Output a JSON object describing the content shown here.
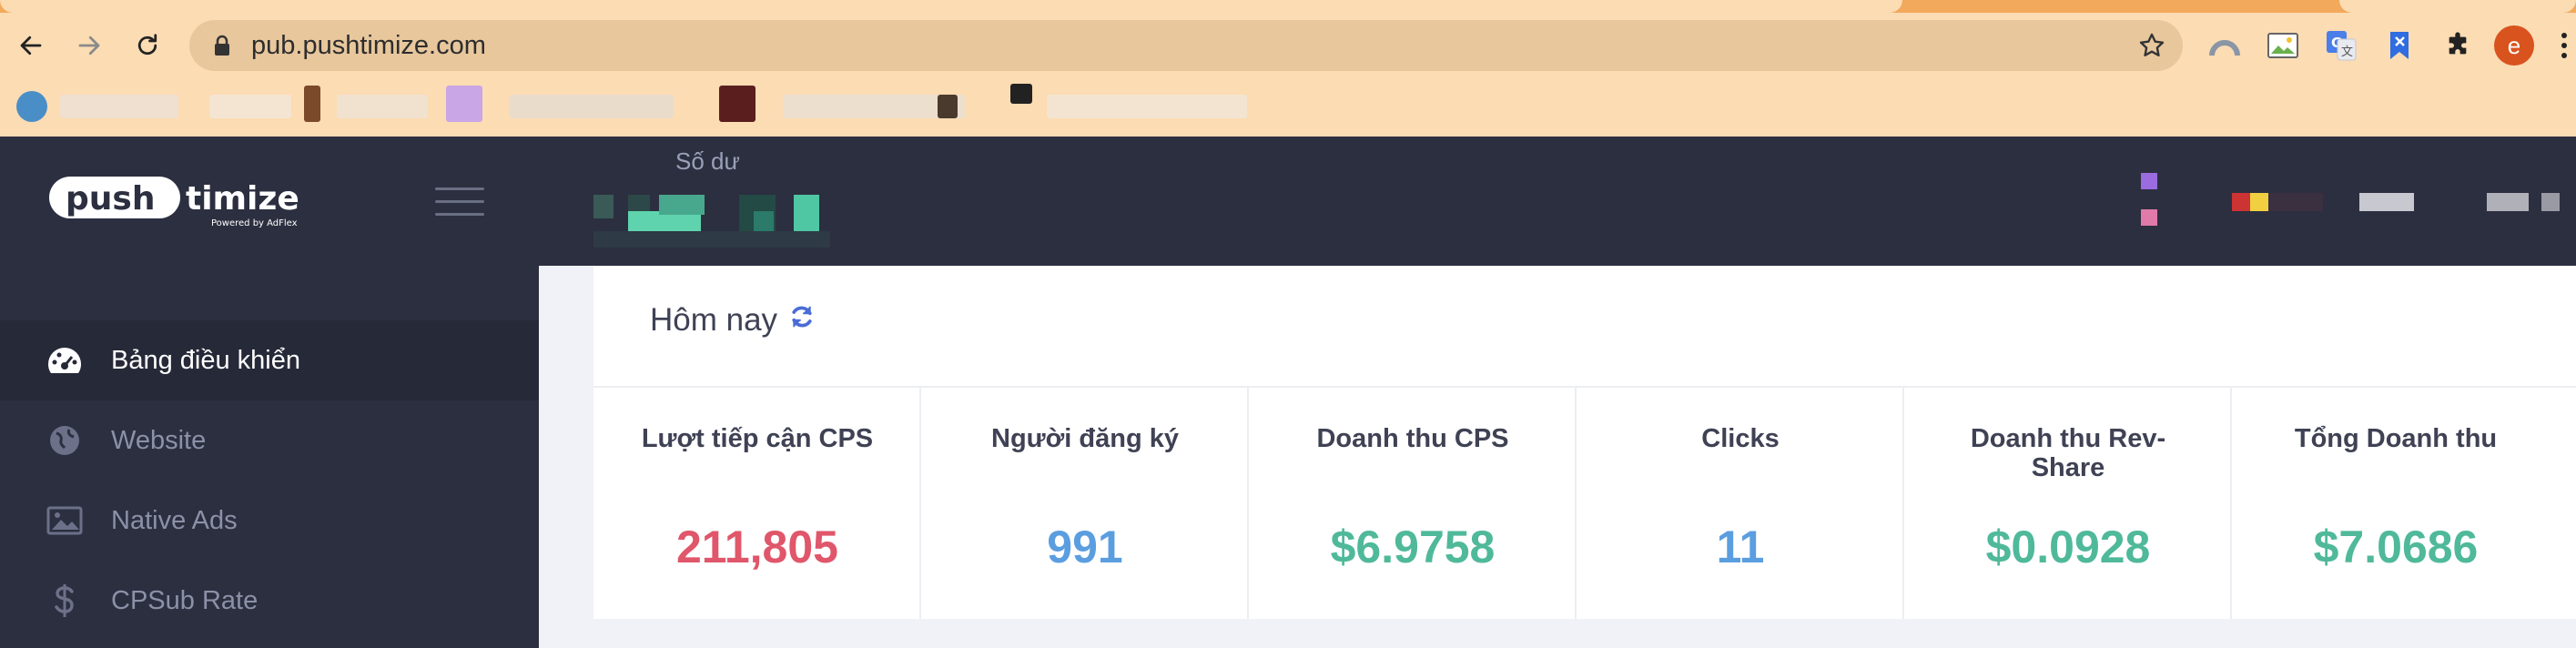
{
  "browser": {
    "url": "pub.pushtimize.com",
    "profile_initial": "e"
  },
  "header": {
    "logo_word_1": "push",
    "logo_word_2": "timize",
    "logo_tagline": "Powered by AdFlex",
    "balance_label": "Số dư"
  },
  "sidebar": {
    "items": [
      {
        "label": "Bảng điều khiển",
        "icon": "dashboard-icon",
        "active": true
      },
      {
        "label": "Website",
        "icon": "globe-icon",
        "active": false
      },
      {
        "label": "Native Ads",
        "icon": "image-icon",
        "active": false
      },
      {
        "label": "CPSub Rate",
        "icon": "dollar-icon",
        "active": false
      }
    ]
  },
  "today_card": {
    "title": "Hôm nay",
    "stats": [
      {
        "label": "Lượt tiếp cận CPS",
        "value": "211,805",
        "color": "#e0566a"
      },
      {
        "label": "Người đăng ký",
        "value": "991",
        "color": "#5b9ee0"
      },
      {
        "label": "Doanh thu CPS",
        "value": "$6.9758",
        "color": "#4fb99a"
      },
      {
        "label": "Clicks",
        "value": "11",
        "color": "#5b9ee0"
      },
      {
        "label": "Doanh thu Rev-Share",
        "value": "$0.0928",
        "color": "#4fb99a"
      },
      {
        "label": "Tổng Doanh thu",
        "value": "$7.0686",
        "color": "#4fb99a"
      }
    ]
  },
  "colors": {
    "chrome_bg": "#fbdcb3",
    "tab_strip": "#f2a95b",
    "app_dark": "#2c2f40",
    "accent_refresh": "#4a6cd6"
  }
}
